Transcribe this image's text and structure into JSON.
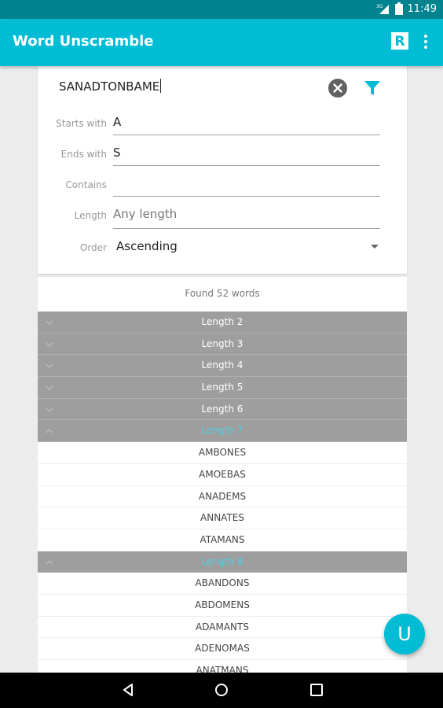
{
  "status": {
    "network": "3G",
    "time": "11:49"
  },
  "appbar": {
    "title": "Word Unscramble",
    "r_icon": "r-badge-icon",
    "menu_icon": "more-vert-icon"
  },
  "search": {
    "value": "SANADTONBAME",
    "clear_icon": "clear-icon",
    "filter_icon": "filter-icon"
  },
  "filters": {
    "starts_with": {
      "label": "Starts with",
      "value": "A"
    },
    "ends_with": {
      "label": "Ends with",
      "value": "S"
    },
    "contains": {
      "label": "Contains",
      "value": ""
    },
    "length": {
      "label": "Length",
      "placeholder": "Any length"
    },
    "order": {
      "label": "Order",
      "value": "Ascending"
    }
  },
  "results": {
    "found": "Found 52 words",
    "groups": [
      {
        "label": "Length 2",
        "expanded": false,
        "words": []
      },
      {
        "label": "Length 3",
        "expanded": false,
        "words": []
      },
      {
        "label": "Length 4",
        "expanded": false,
        "words": []
      },
      {
        "label": "Length 5",
        "expanded": false,
        "words": []
      },
      {
        "label": "Length 6",
        "expanded": false,
        "words": []
      },
      {
        "label": "Length 7",
        "expanded": true,
        "words": [
          "AMBONES",
          "AMOEBAS",
          "ANADEMS",
          "ANNATES",
          "ATAMANS"
        ]
      },
      {
        "label": "Length 8",
        "expanded": true,
        "words": [
          "ABANDONS",
          "ABDOMENS",
          "ADAMANTS",
          "ADENOMAS",
          "ANATMANS"
        ]
      }
    ]
  },
  "fab": {
    "label": "U"
  },
  "colors": {
    "primary": "#00bcd4",
    "primary_dark": "#00838f",
    "accent_text": "#4dd0e1",
    "group_bg": "#9e9e9e"
  },
  "nav": {
    "back_icon": "back-icon",
    "home_icon": "home-icon",
    "recents_icon": "recents-icon"
  }
}
